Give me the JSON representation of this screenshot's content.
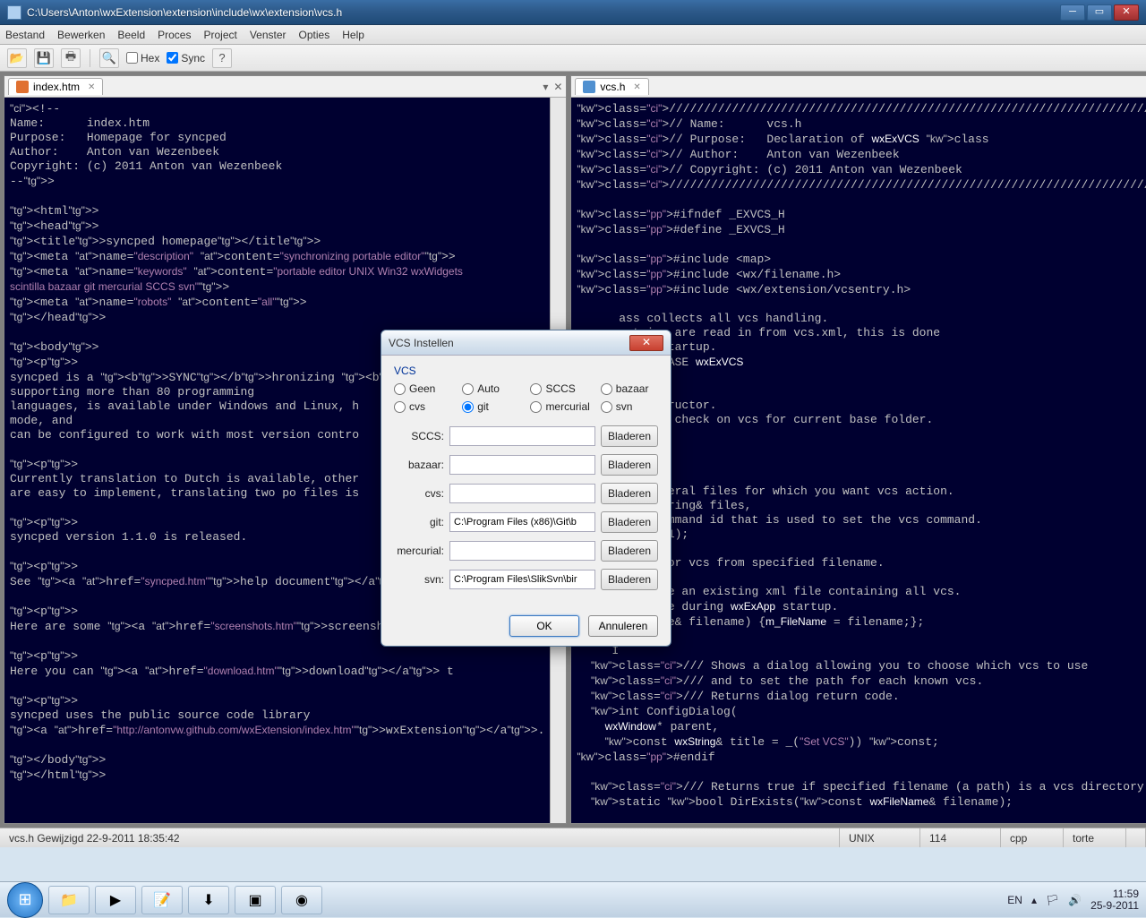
{
  "window": {
    "title": "C:\\Users\\Anton\\wxExtension\\extension\\include\\wx\\extension\\vcs.h"
  },
  "menu": {
    "items": [
      "Bestand",
      "Bewerken",
      "Beeld",
      "Proces",
      "Project",
      "Venster",
      "Opties",
      "Help"
    ]
  },
  "toolbar": {
    "hex": "Hex",
    "sync": "Sync"
  },
  "tabs": {
    "left": "index.htm",
    "right": "vcs.h"
  },
  "dialog": {
    "title": "VCS Instellen",
    "group": "VCS",
    "radios": [
      "Geen",
      "Auto",
      "SCCS",
      "bazaar",
      "cvs",
      "git",
      "mercurial",
      "svn"
    ],
    "selected": "git",
    "rows": [
      {
        "label": "SCCS:",
        "value": ""
      },
      {
        "label": "bazaar:",
        "value": ""
      },
      {
        "label": "cvs:",
        "value": ""
      },
      {
        "label": "git:",
        "value": "C:\\Program Files (x86)\\Git\\b"
      },
      {
        "label": "mercurial:",
        "value": ""
      },
      {
        "label": "svn:",
        "value": "C:\\Program Files\\SlikSvn\\bir"
      }
    ],
    "browse": "Bladeren",
    "ok": "OK",
    "cancel": "Annuleren"
  },
  "status": {
    "left": "vcs.h Gewijzigd 22-9-2011 18:35:42",
    "cells": [
      "UNIX",
      "114",
      "cpp",
      "torte"
    ]
  },
  "systray": {
    "lang": "EN",
    "time": "11:59",
    "date": "25-9-2011"
  },
  "code_left": "<!--\nName:      index.htm\nPurpose:   Homepage for syncped\nAuthor:    Anton van Wezenbeek\nCopyright: (c) 2011 Anton van Wezenbeek\n-->\n\n<html>\n<head>\n<title>syncped homepage</title>\n<meta name=\"description\" content=\"synchronizing portable editor\">\n<meta name=\"keywords\" content=\"portable editor UNIX Win32 wxWidgets\nscintilla bazaar git mercurial SCCS svn\">\n<meta name=\"robots\" content=\"all\">\n</head>\n\n<body>\n<p>\nsyncped is a <b>SYNC</b>hronizing <b>P</b>ortable\nsupporting more than 80 programming\nlanguages, is available under Windows and Linux, h\nmode, and\ncan be configured to work with most version contro\n\n<p>\nCurrently translation to Dutch is available, other\nare easy to implement, translating two po files is\n\n<p>\nsyncped version 1.1.0 is released.\n\n<p>\nSee <a href=\"syncped.htm\">help document</a>.\n\n<p>\nHere are some <a href=\"screenshots.htm\">screenshot\n\n<p>\nHere you can <a href=\"download.htm\">download</a> t\n\n<p>\nsyncped uses the public source code library\n<a href=\"http://antonvw.github.com/wxExtension/index.htm\">wxExtension</a>.\n\n</body>\n</html>",
  "code_right": "////////////////////////////////////////////////////////////////////////////////\n// Name:      vcs.h\n// Purpose:   Declaration of wxExVCS class\n// Author:    Anton van Wezenbeek\n// Copyright: (c) 2011 Anton van Wezenbeek\n////////////////////////////////////////////////////////////////////////////////\n\n#ifndef _EXVCS_H\n#define _EXVCS_H\n\n#include <map>\n#include <wx/filename.h>\n#include <wx/extension/vcsentry.h>\n\n      ass collects all vcs handling.\n      entries are read in from vcs.xml, this is done\n     xExApp startup.\n     IMPEXP_BASE wxExVCS\n\n\n     lt constructor.\n     etDir to check on vcs for current base folder.\n\n\n     ructor.\n\n     cify several files for which you want vcs action.\n     xArrayString& files,\n      menu command id that is used to set the vcs command.\n     u_id = -1);\n\n     ructor for vcs from specified filename.\n\n     s must be an existing xml file containing all vcs.\n     s is done during wxExApp startup.\n     xFileName& filename) {m_FileName = filename;};\n\n     I\n  /// Shows a dialog allowing you to choose which vcs to use\n  /// and to set the path for each known vcs.\n  /// Returns dialog return code.\n  int ConfigDialog(\n    wxWindow* parent,\n    const wxString& title = _(\"Set VCS\")) const;\n#endif\n\n  /// Returns true if specified filename (a path) is a vcs directory.\n  static bool DirExists(const wxFileName& filename);"
}
